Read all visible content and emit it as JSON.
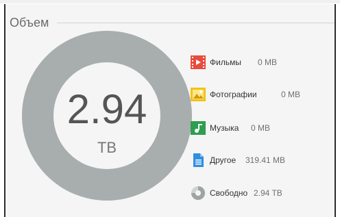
{
  "panel": {
    "title": "Объем"
  },
  "storage": {
    "total_value": "2.94",
    "total_unit": "TB",
    "free_fraction": 1.0,
    "ring_color": "#a8adad",
    "inner_color": "#f5f5f5"
  },
  "legend": {
    "items": [
      {
        "icon": "film-icon",
        "name": "Фильмы",
        "size": "0 MB",
        "color": "#e74c3c"
      },
      {
        "icon": "photo-icon",
        "name": "Фотографии",
        "size": "0 MB",
        "color": "#f0c419"
      },
      {
        "icon": "music-icon",
        "name": "Музыка",
        "size": "0 MB",
        "color": "#2e9e4f"
      },
      {
        "icon": "document-icon",
        "name": "Другое",
        "size": "319.41 MB",
        "color": "#2f8fe0"
      },
      {
        "icon": "free-space-icon",
        "name": "Свободно",
        "size": "2.94 TB",
        "color": "#9ea4a4"
      }
    ]
  }
}
